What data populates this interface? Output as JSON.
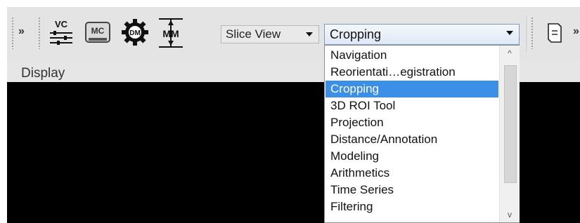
{
  "toolbar": {
    "overflow_left": "»",
    "overflow_right": "»",
    "vc_label": "VC",
    "mc_label": "MC",
    "dm_label": "DM",
    "mm_label": "MM",
    "slice_view_label": "Slice View",
    "module_selected": "Cropping"
  },
  "panel": {
    "display_label": "Display"
  },
  "dropdown": {
    "items": [
      "Navigation",
      "Reorientati…egistration",
      "Cropping",
      "3D ROI Tool",
      "Projection",
      "Distance/Annotation",
      "Modeling",
      "Arithmetics",
      "Time Series",
      "Filtering"
    ],
    "selected_index": 2,
    "scroll_up": "^",
    "scroll_down": "v"
  },
  "colors": {
    "selection": "#3b8fe6",
    "viewport": "#000000"
  },
  "icons": {
    "vc": "visual-controls-sliders-icon",
    "mc": "memory-card-icon",
    "dm": "gear-icon",
    "mm": "measure-icon",
    "far_right": "document-icon"
  }
}
